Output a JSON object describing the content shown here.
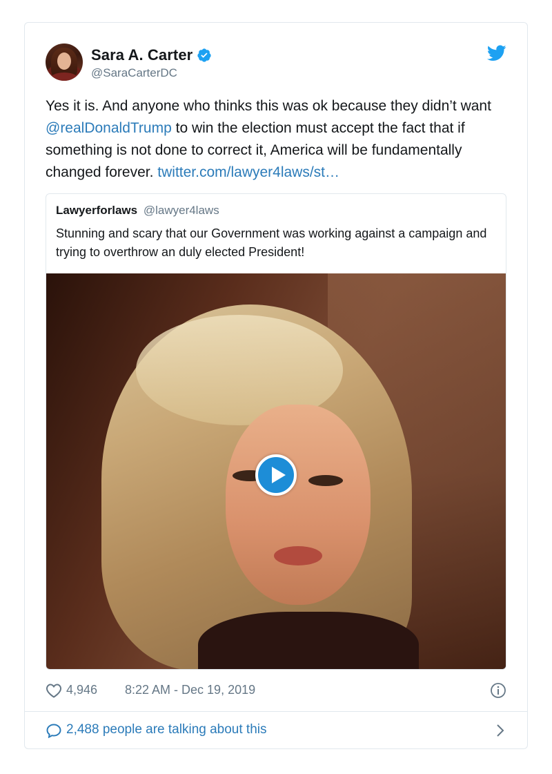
{
  "author": {
    "name": "Sara A. Carter",
    "handle": "@SaraCarterDC",
    "verified": true
  },
  "tweet": {
    "text_part1": "Yes it is. And anyone who thinks this was ok because they didn’t want ",
    "mention": "@realDonaldTrump",
    "text_part2": " to win the election must accept the fact that if something is not done to correct it, America will be fundamentally changed forever. ",
    "link": "twitter.com/lawyer4laws/st…"
  },
  "quoted_tweet": {
    "name": "Lawyerforlaws",
    "handle": "@lawyer4laws",
    "text": "Stunning and scary that our Government was working against a campaign and trying to overthrow an duly elected President!",
    "media": "video"
  },
  "meta": {
    "likes": "4,946",
    "timestamp": "8:22 AM - Dec 19, 2019"
  },
  "talking": {
    "text": "2,488 people are talking about this"
  },
  "icons": {
    "verified": "verified-badge-icon",
    "platform": "twitter-bird-icon",
    "like": "heart-icon",
    "info": "info-icon",
    "reply": "speech-bubble-icon",
    "more": "chevron-right-icon",
    "play": "play-icon"
  },
  "colors": {
    "link": "#2b7bb9",
    "brand": "#1da1f2",
    "muted": "#657786",
    "border": "#e1e8ed"
  }
}
